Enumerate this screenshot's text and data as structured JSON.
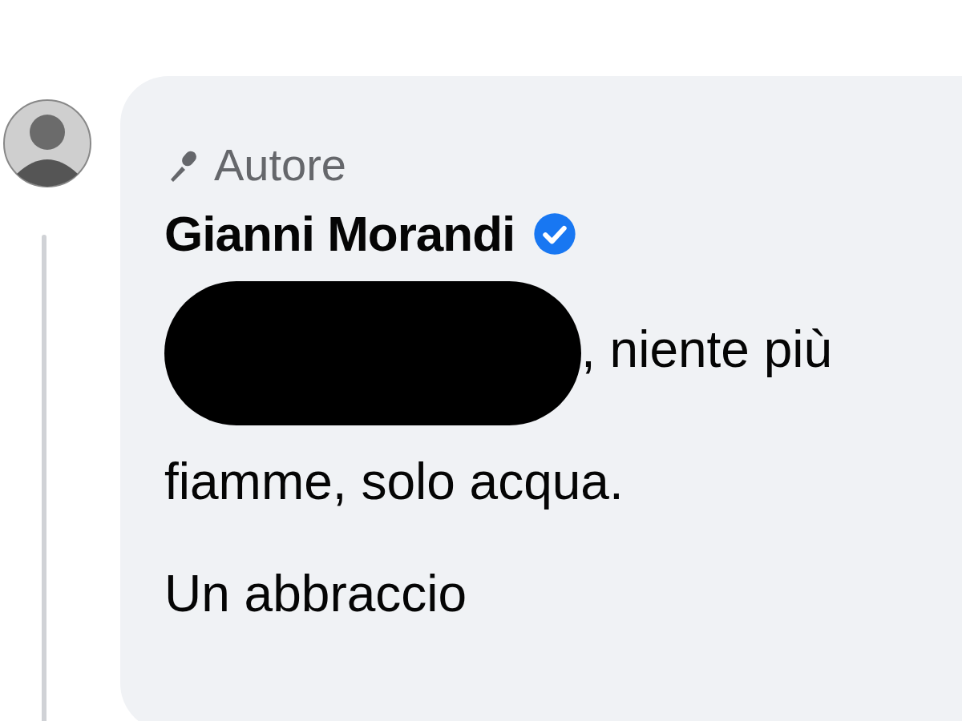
{
  "comment": {
    "role_label": "Autore",
    "author": "Gianni Morandi",
    "verified": true,
    "redacted": true,
    "text": ", niente più fiamme, solo acqua.\nUn abbraccio"
  }
}
